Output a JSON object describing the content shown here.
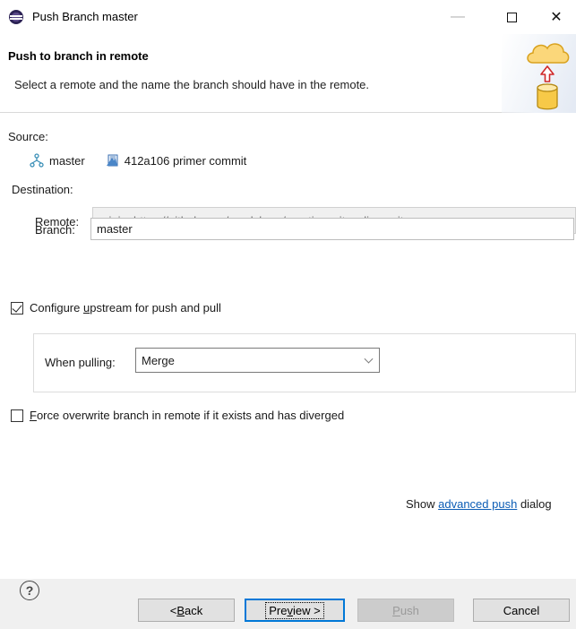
{
  "window": {
    "title": "Push Branch master",
    "minimize_glyph": "—",
    "close_glyph": "✕"
  },
  "banner": {
    "title": "Push to branch in remote",
    "description": "Select a remote and the name the branch should have in the remote.",
    "art_icon": "cloud-push-database-icon"
  },
  "source": {
    "label": "Source:",
    "branch_icon": "branch-icon",
    "branch": "master",
    "commit_icon": "commit-icon",
    "commit": "412a106 primer commit"
  },
  "destination": {
    "label": "Destination:",
    "remote_label": "Remote:",
    "remote_value": "origin: https://github.com/mcolchero/practica_git_eclipse.git",
    "branch_label": "Branch:",
    "branch_value": "master"
  },
  "upstream": {
    "checked": true,
    "label_pre": "Configure ",
    "label_mnemonic": "u",
    "label_post": "pstream for push and pull",
    "when_pulling_label": "When pulling:",
    "when_pulling_value": "Merge"
  },
  "force": {
    "checked": false,
    "label_mnemonic": "F",
    "label_post": "orce overwrite branch in remote if it exists and has diverged"
  },
  "advanced": {
    "prefix": "Show ",
    "link": "advanced push",
    "suffix": " dialog"
  },
  "footer": {
    "help_glyph": "?",
    "back_pre": "< ",
    "back_mnemonic": "B",
    "back_post": "ack",
    "preview_pre": "Pre",
    "preview_mnemonic": "v",
    "preview_post": "iew >",
    "push_mnemonic": "P",
    "push_post": "ush",
    "cancel": "Cancel"
  },
  "colors": {
    "link": "#0b5cb5",
    "default_button_border": "#0078d7",
    "footer_bg": "#f0f0f0"
  }
}
